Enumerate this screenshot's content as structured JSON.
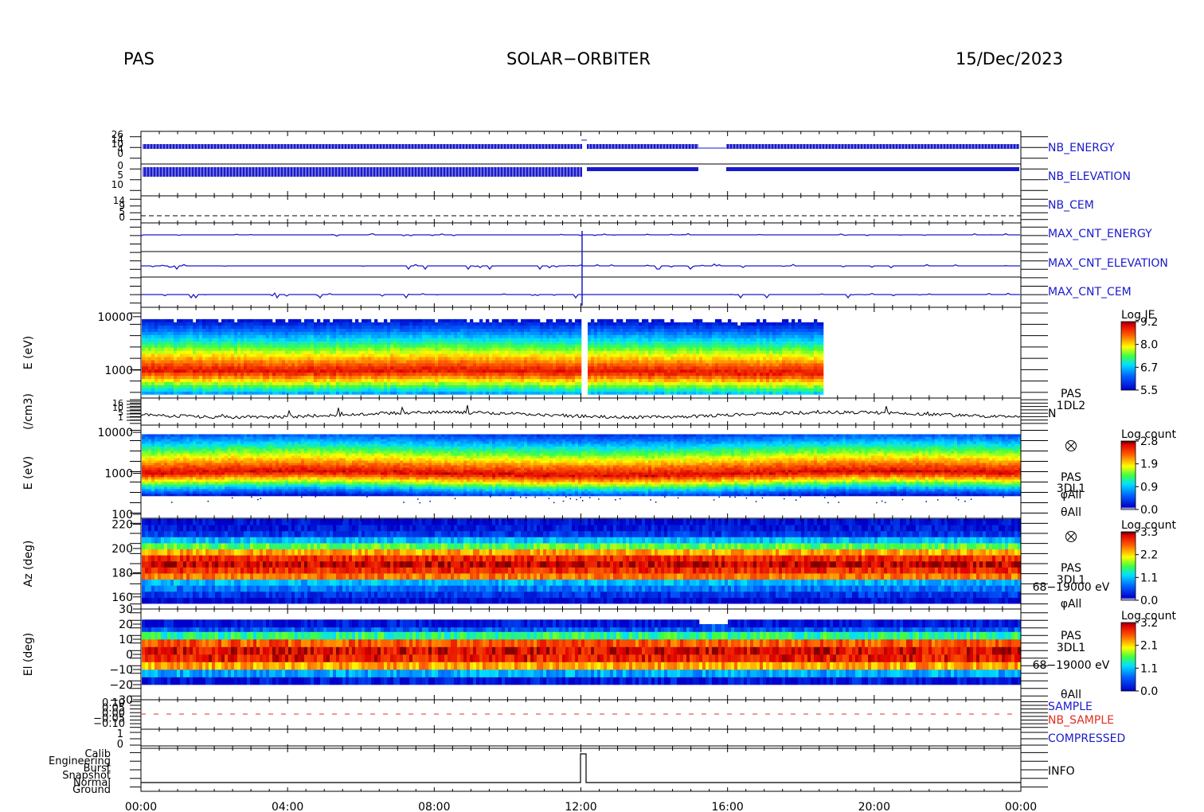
{
  "header": {
    "left": "PAS",
    "center": "SOLAR−ORBITER",
    "right": "15/Dec/2023"
  },
  "x_ticks": [
    "00:00",
    "04:00",
    "08:00",
    "12:00",
    "16:00",
    "20:00",
    "00:00"
  ],
  "colors": {
    "blue": "#1a1acc",
    "red": "#e03020"
  },
  "panels": [
    {
      "id": "nb",
      "labels": [
        "NB_ENERGY",
        "NB_ELEVATION"
      ]
    },
    {
      "id": "cem",
      "labels": [
        "NB_CEM"
      ]
    },
    {
      "id": "maxcnt",
      "labels": [
        "MAX_CNT_ENERGY",
        "MAX_CNT_ELEVATION",
        "MAX_CNT_CEM"
      ]
    },
    {
      "id": "spec1",
      "ylabel": "E (eV)",
      "ticks": [
        "10000",
        "1000"
      ],
      "colorbar": {
        "title": "Log JE",
        "ticks": [
          "9.2",
          "8.0",
          "6.7",
          "5.5"
        ]
      }
    },
    {
      "id": "dens",
      "ylabel": "(/cm3)",
      "side": [
        "PAS",
        "1DL2",
        "N"
      ]
    },
    {
      "id": "spec2",
      "ylabel": "E (eV)",
      "ticks": [
        "10000",
        "1000",
        "100"
      ],
      "side": [
        "PAS",
        "3DL1",
        "φAll",
        "θAll"
      ],
      "colorbar": {
        "title": "Log count",
        "ticks": [
          "2.8",
          "1.9",
          "0.9",
          "0.0"
        ]
      }
    },
    {
      "id": "az",
      "ylabel": "Az (deg)",
      "ticks": [
        "220",
        "200",
        "180",
        "160"
      ],
      "side": [
        "PAS",
        "3DL1",
        "68−19000 eV",
        "φAll"
      ],
      "colorbar": {
        "title": "Log count",
        "ticks": [
          "3.3",
          "2.2",
          "1.1",
          "0.0"
        ]
      }
    },
    {
      "id": "el",
      "ylabel": "El (deg)",
      "ticks": [
        "30",
        "20",
        "10",
        "0",
        "−10",
        "−20",
        "−30"
      ],
      "side": [
        "PAS",
        "3DL1",
        "68−19000 eV",
        "θAll"
      ],
      "colorbar": {
        "title": "Log count",
        "ticks": [
          "3.2",
          "2.1",
          "1.1",
          "0.0"
        ]
      }
    },
    {
      "id": "sample",
      "labels": [
        "SAMPLE",
        "NB_SAMPLE"
      ],
      "ticks": [
        "0.10",
        "0.05",
        "0.00",
        "−0.05",
        "−0.10"
      ]
    },
    {
      "id": "compressed",
      "labels": [
        "COMPRESSED"
      ],
      "ticks": [
        "1",
        "0"
      ]
    },
    {
      "id": "info",
      "labels": [
        "INFO"
      ],
      "ticks": [
        "Calib",
        "Engineering",
        "Burst",
        "Snapshot",
        "Normal",
        "Ground"
      ]
    }
  ],
  "chart_data": {
    "type": "heatmap",
    "title": "SOLAR−ORBITER",
    "x": {
      "start": "2023-12-15 00:00",
      "end": "2023-12-16 00:00",
      "tick_labels": [
        "00:00",
        "04:00",
        "08:00",
        "12:00",
        "16:00",
        "20:00",
        "00:00"
      ]
    },
    "panels": [
      {
        "name": "PAS 1DL2 energy spectrogram",
        "ylabel": "E (eV)",
        "yscale": "log",
        "ylim": [
          300,
          15000
        ],
        "z_label": "Log JE",
        "zlim": [
          5.5,
          9.2
        ],
        "data_end": "18:35",
        "peak_energy_eV": {
          "times": [
            "00:00",
            "04:00",
            "08:00",
            "12:00",
            "16:00",
            "18:30"
          ],
          "values": [
            1000,
            950,
            1000,
            950,
            900,
            900
          ]
        }
      },
      {
        "name": "PAS 1DL2 N",
        "ylabel": "(/cm3)"
      },
      {
        "name": "PAS 3DL1 energy spectrogram",
        "ylabel": "E (eV)",
        "yscale": "log",
        "ylim": [
          80,
          15000
        ],
        "z_label": "Log count",
        "zlim": [
          0.0,
          2.8
        ]
      },
      {
        "name": "PAS 3DL1 azimuth",
        "ylabel": "Az (deg)",
        "ylim": [
          150,
          225
        ],
        "energy_range": "68−19000 eV",
        "z_label": "Log count",
        "zlim": [
          0.0,
          3.3
        ]
      },
      {
        "name": "PAS 3DL1 elevation",
        "ylabel": "El (deg)",
        "ylim": [
          -30,
          30
        ],
        "energy_range": "68−19000 eV",
        "z_label": "Log count",
        "zlim": [
          0.0,
          3.2
        ]
      }
    ],
    "info_mode": {
      "levels": [
        "Calib",
        "Engineering",
        "Burst",
        "Snapshot",
        "Normal",
        "Ground"
      ],
      "burst_window": [
        "12:00",
        "12:15"
      ]
    }
  }
}
